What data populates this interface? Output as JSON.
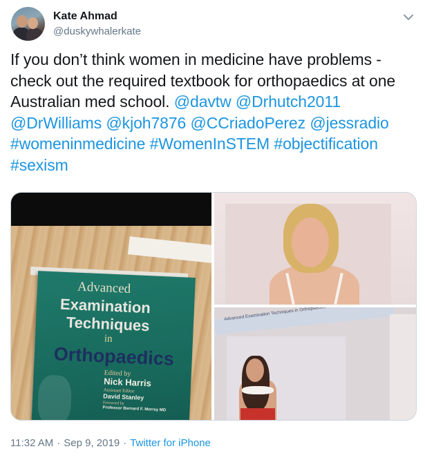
{
  "author": {
    "name": "Kate Ahmad",
    "handle": "@duskywhalerkate",
    "avatar_icon": "profile-photo"
  },
  "tweet": {
    "text_plain": "If you don’t think women in medicine have problems - check out the required textbook for orthopaedics at one Australian med school. ",
    "mentions": [
      "@davtw",
      "@Drhutch2011",
      "@DrWilliams",
      "@kjoh7876",
      "@CCriadoPerez",
      "@jessradio"
    ],
    "hashtags": [
      "#womeninmedicine",
      "#WomenInSTEM",
      "#objectification",
      "#sexism"
    ]
  },
  "media": {
    "book_cover": {
      "title_line1": "Advanced",
      "title_line2": "Examination",
      "title_line3": "Techniques",
      "title_line4": "in",
      "title_line5": "Orthopaedics",
      "edited_by_label": "Edited by",
      "editor": "Nick Harris",
      "assistant_label": "Assistant Editor",
      "assistant": "David Stanley",
      "foreword_label": "Foreword by",
      "foreword": "Professor Bernard F. Morrey MD"
    },
    "page_header": "Advanced Examination Techniques in Orthopaedics"
  },
  "footer": {
    "time": "11:32 AM",
    "date": "Sep 9, 2019",
    "separator": "·",
    "source": "Twitter for iPhone"
  },
  "colors": {
    "link": "#1b95e0",
    "secondary_text": "#657786",
    "primary_text": "#14171a",
    "book_cover": "#1f7a6a"
  }
}
